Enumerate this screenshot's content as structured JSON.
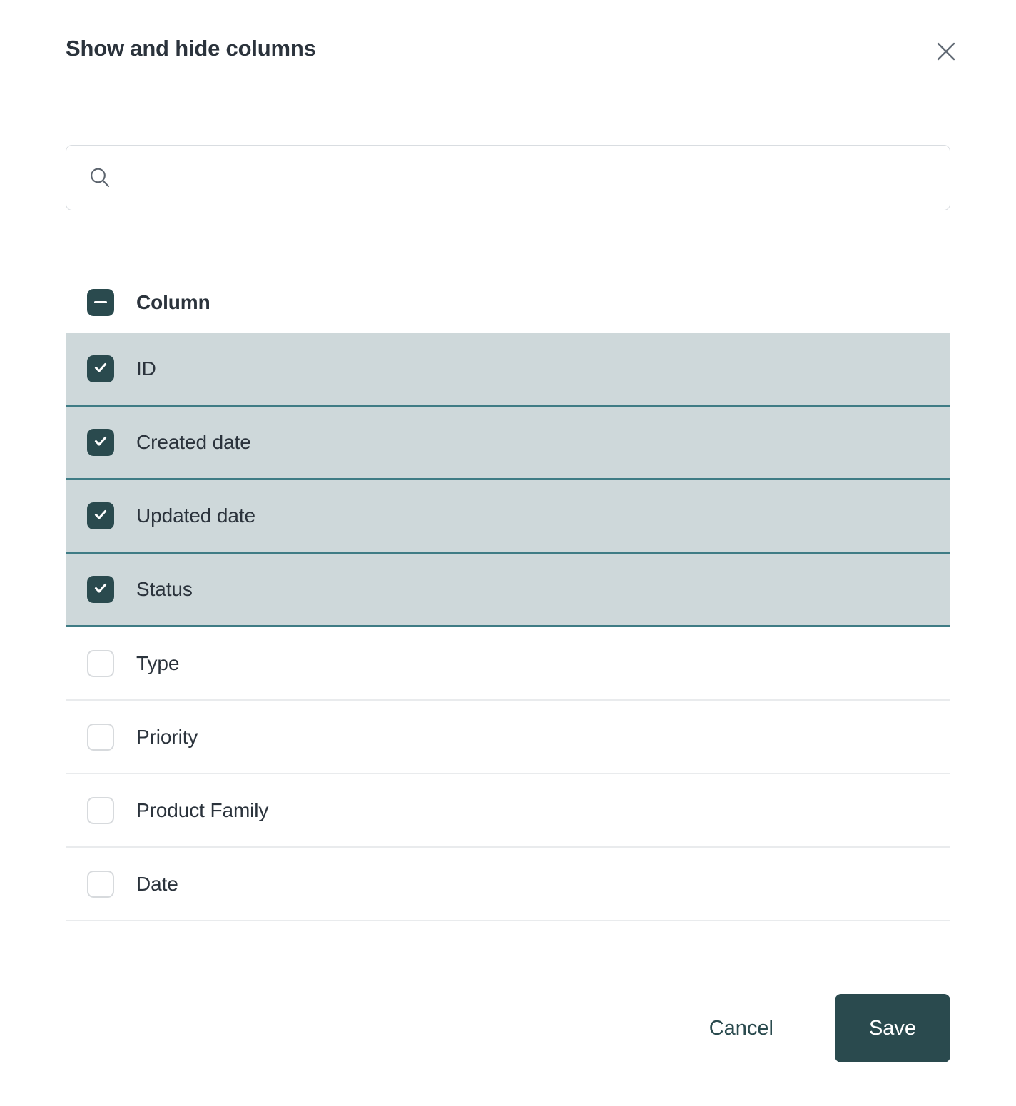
{
  "dialog": {
    "title": "Show and hide columns",
    "close_icon": "close-icon"
  },
  "search": {
    "icon": "search-icon",
    "value": "",
    "placeholder": ""
  },
  "list": {
    "header": {
      "label": "Column",
      "checkbox_state": "indeterminate"
    },
    "rows": [
      {
        "label": "ID",
        "checked": true
      },
      {
        "label": "Created date",
        "checked": true
      },
      {
        "label": "Updated date",
        "checked": true
      },
      {
        "label": "Status",
        "checked": true
      },
      {
        "label": "Type",
        "checked": false
      },
      {
        "label": "Priority",
        "checked": false
      },
      {
        "label": "Product Family",
        "checked": false
      },
      {
        "label": "Date",
        "checked": false
      }
    ]
  },
  "footer": {
    "cancel_label": "Cancel",
    "save_label": "Save"
  },
  "colors": {
    "accent": "#2a4a4e",
    "selected_row_bg": "#ced8da",
    "selected_row_border": "#3f7c85",
    "divider": "#e9ebed",
    "text": "#2b333c",
    "muted": "#6b7280"
  }
}
